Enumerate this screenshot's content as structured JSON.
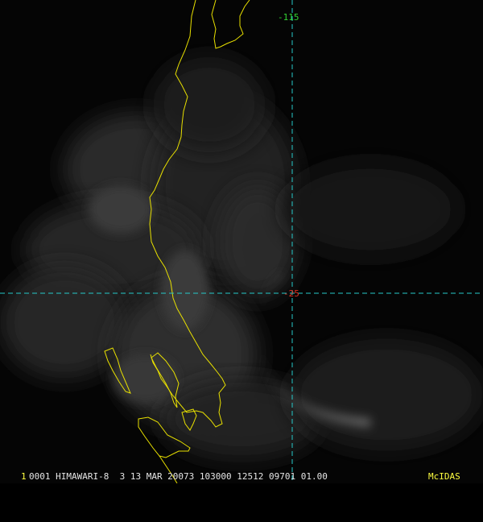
{
  "status_bar": {
    "frame_number": "1",
    "product_line": "0001 HIMAWARI-8  3 13 MAR 20073 103000 12512 09701 01.00",
    "software": "McIDAS"
  },
  "grid": {
    "longitude_label": "-115",
    "latitude_label": "-25"
  },
  "colors": {
    "background": "#000000",
    "coastline": "#e8e000",
    "grid_line": "#25c9c9",
    "longitude_label": "#32d232",
    "latitude_label": "#e03020",
    "status_text": "#e6e6e6",
    "brand_text": "#ffff40"
  }
}
